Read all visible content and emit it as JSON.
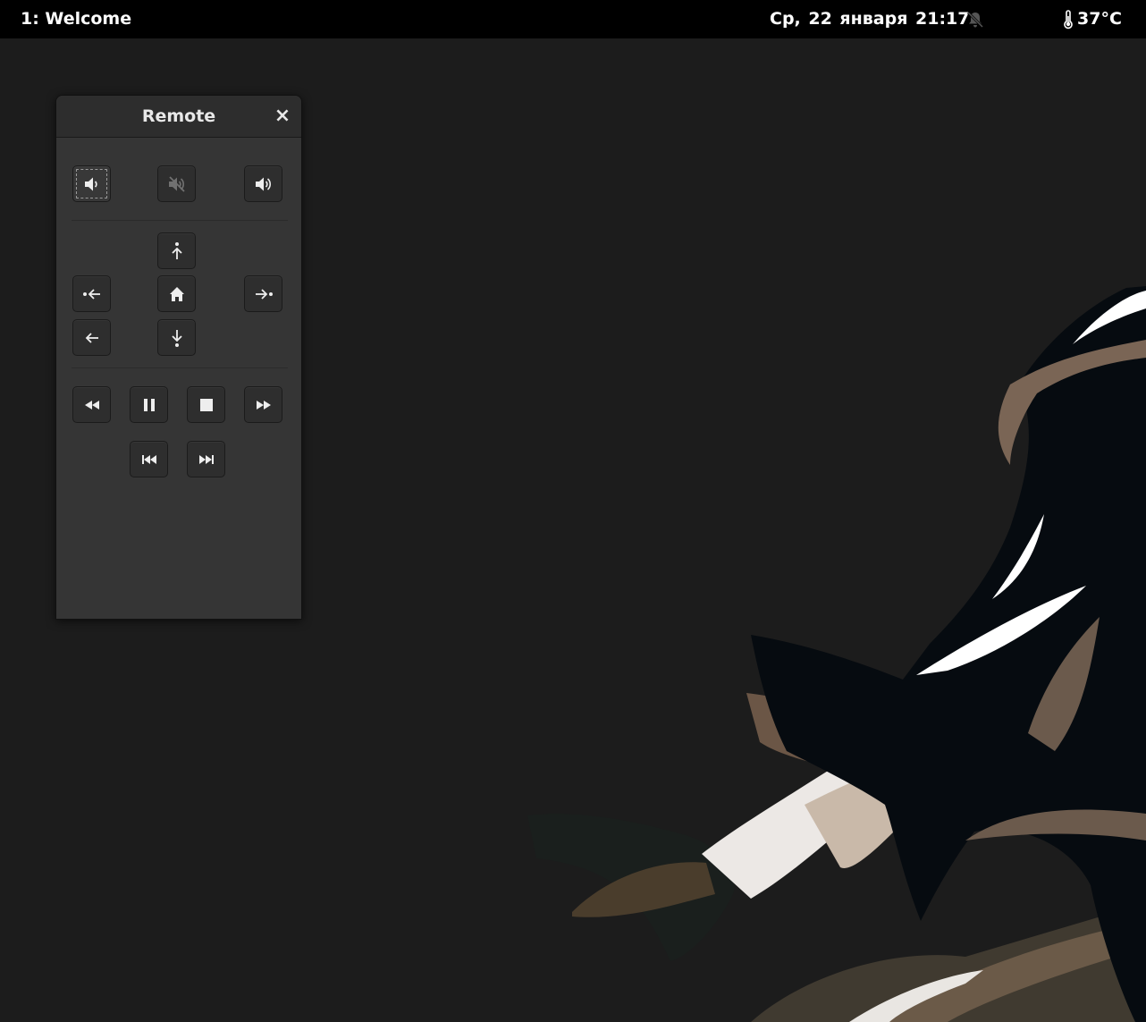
{
  "topbar": {
    "workspace": "1: Welcome",
    "clock": "Ср, 22 января  21:17",
    "temperature": "37°C"
  },
  "window": {
    "title": "Remote",
    "close_symbol": "×"
  },
  "buttons": {
    "volume_row": [
      "volume-down-icon",
      "mute-icon",
      "volume-up-icon"
    ],
    "navigation": [
      "up-icon",
      "back-in-icon",
      "home-icon",
      "forward-out-icon",
      "back-arrow-icon",
      "down-icon"
    ],
    "transport_row1": [
      "rewind-icon",
      "pause-icon",
      "stop-icon",
      "fast-forward-icon"
    ],
    "transport_row2": [
      "skip-previous-icon",
      "skip-next-icon"
    ]
  },
  "colors": {
    "topbar": "#000000",
    "window_bg": "#353535",
    "button_bg": "#2e2e2e",
    "desktop_bg": "#1c1c1c"
  }
}
